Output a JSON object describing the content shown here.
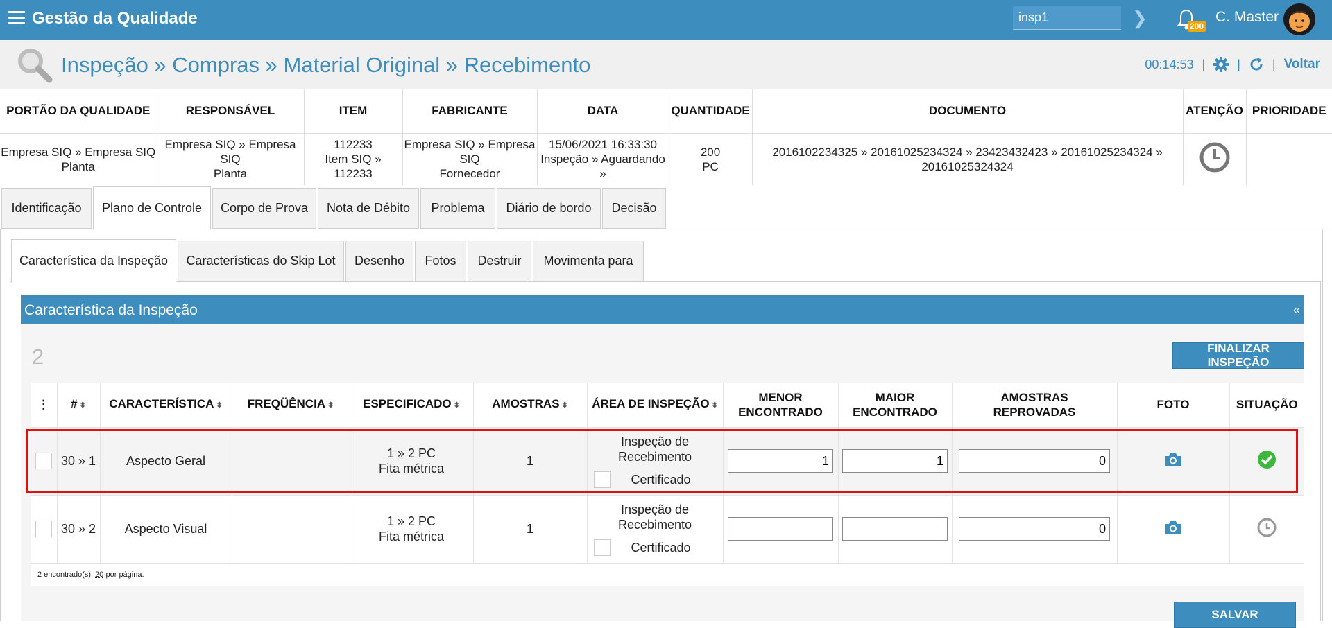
{
  "topbar": {
    "app_title": "Gestão da Qualidade",
    "search_value": "insp1",
    "notification_count": "200",
    "user_name": "C. Master"
  },
  "page_header": {
    "breadcrumb": "Inspeção » Compras » Material Original » Recebimento",
    "timer": "00:14:53",
    "back_label": "Voltar"
  },
  "info": {
    "headers": [
      "PORTÃO DA QUALIDADE",
      "RESPONSÁVEL",
      "ITEM",
      "FABRICANTE",
      "DATA",
      "QUANTIDADE",
      "DOCUMENTO",
      "ATENÇÃO",
      "PRIORIDADE"
    ],
    "portao": [
      "Empresa SIQ » Empresa SIQ",
      "Planta"
    ],
    "responsavel": [
      "Empresa SIQ » Empresa SIQ",
      "Planta"
    ],
    "item": [
      "112233",
      "Item SIQ » 112233"
    ],
    "fabricante": [
      "Empresa SIQ » Empresa SIQ",
      "Fornecedor"
    ],
    "data": [
      "15/06/2021 16:33:30",
      "Inspeção » Aguardando »"
    ],
    "quantidade": [
      "200",
      "PC"
    ],
    "documento": "20161022343​25 » 20161025234324 » 23423432423 » 20161025234324 » 20161025324324"
  },
  "tabs_main": [
    "Identificação",
    "Plano de Controle",
    "Corpo de Prova",
    "Nota de Débito",
    "Problema",
    "Diário de bordo",
    "Decisão"
  ],
  "tabs_sub": [
    "Característica da Inspeção",
    "Características do Skip Lot",
    "Desenho",
    "Fotos",
    "Destruir",
    "Movimenta para"
  ],
  "panel": {
    "title": "Característica da Inspeção",
    "collapse": "«",
    "count": "2",
    "finalize_label": "FINALIZAR INSPEÇÃO",
    "save_label": "SALVAR"
  },
  "grid": {
    "headers": {
      "menu": "⋮",
      "num": "#",
      "caracteristica": "CARACTERÍSTICA",
      "frequencia": "FREQÜÊNCIA",
      "especificado": "ESPECIFICADO",
      "amostras": "AMOSTRAS",
      "area": "ÁREA DE INSPEÇÃO",
      "menor_1": "MENOR",
      "menor_2": "ENCONTRADO",
      "maior_1": "MAIOR",
      "maior_2": "ENCONTRADO",
      "reprov_1": "AMOSTRAS",
      "reprov_2": "REPROVADAS",
      "foto": "FOTO",
      "situacao": "SITUAÇÃO"
    },
    "rows": [
      {
        "num": "30 » 1",
        "caracteristica": "Aspecto Geral",
        "frequencia": "",
        "especificado_1": "1 » 2 PC",
        "especificado_2": "Fita métrica",
        "amostras": "1",
        "area_1": "Inspeção de",
        "area_2": "Recebimento",
        "certificado": "Certificado",
        "menor": "1",
        "maior": "1",
        "reprovadas": "0",
        "situacao": "approved"
      },
      {
        "num": "30 » 2",
        "caracteristica": "Aspecto Visual",
        "frequencia": "",
        "especificado_1": "1 » 2 PC",
        "especificado_2": "Fita métrica",
        "amostras": "1",
        "area_1": "Inspeção de",
        "area_2": "Recebimento",
        "certificado": "Certificado",
        "menor": "",
        "maior": "",
        "reprovadas": "0",
        "situacao": "pending"
      }
    ],
    "footer_found": "2 encontrado(s),",
    "footer_per_page": "20",
    "footer_suffix": "por página."
  },
  "colors": {
    "accent": "#3d8dbf",
    "success": "#3db83d",
    "highlight": "#e01010",
    "badge": "#f0a30a"
  }
}
